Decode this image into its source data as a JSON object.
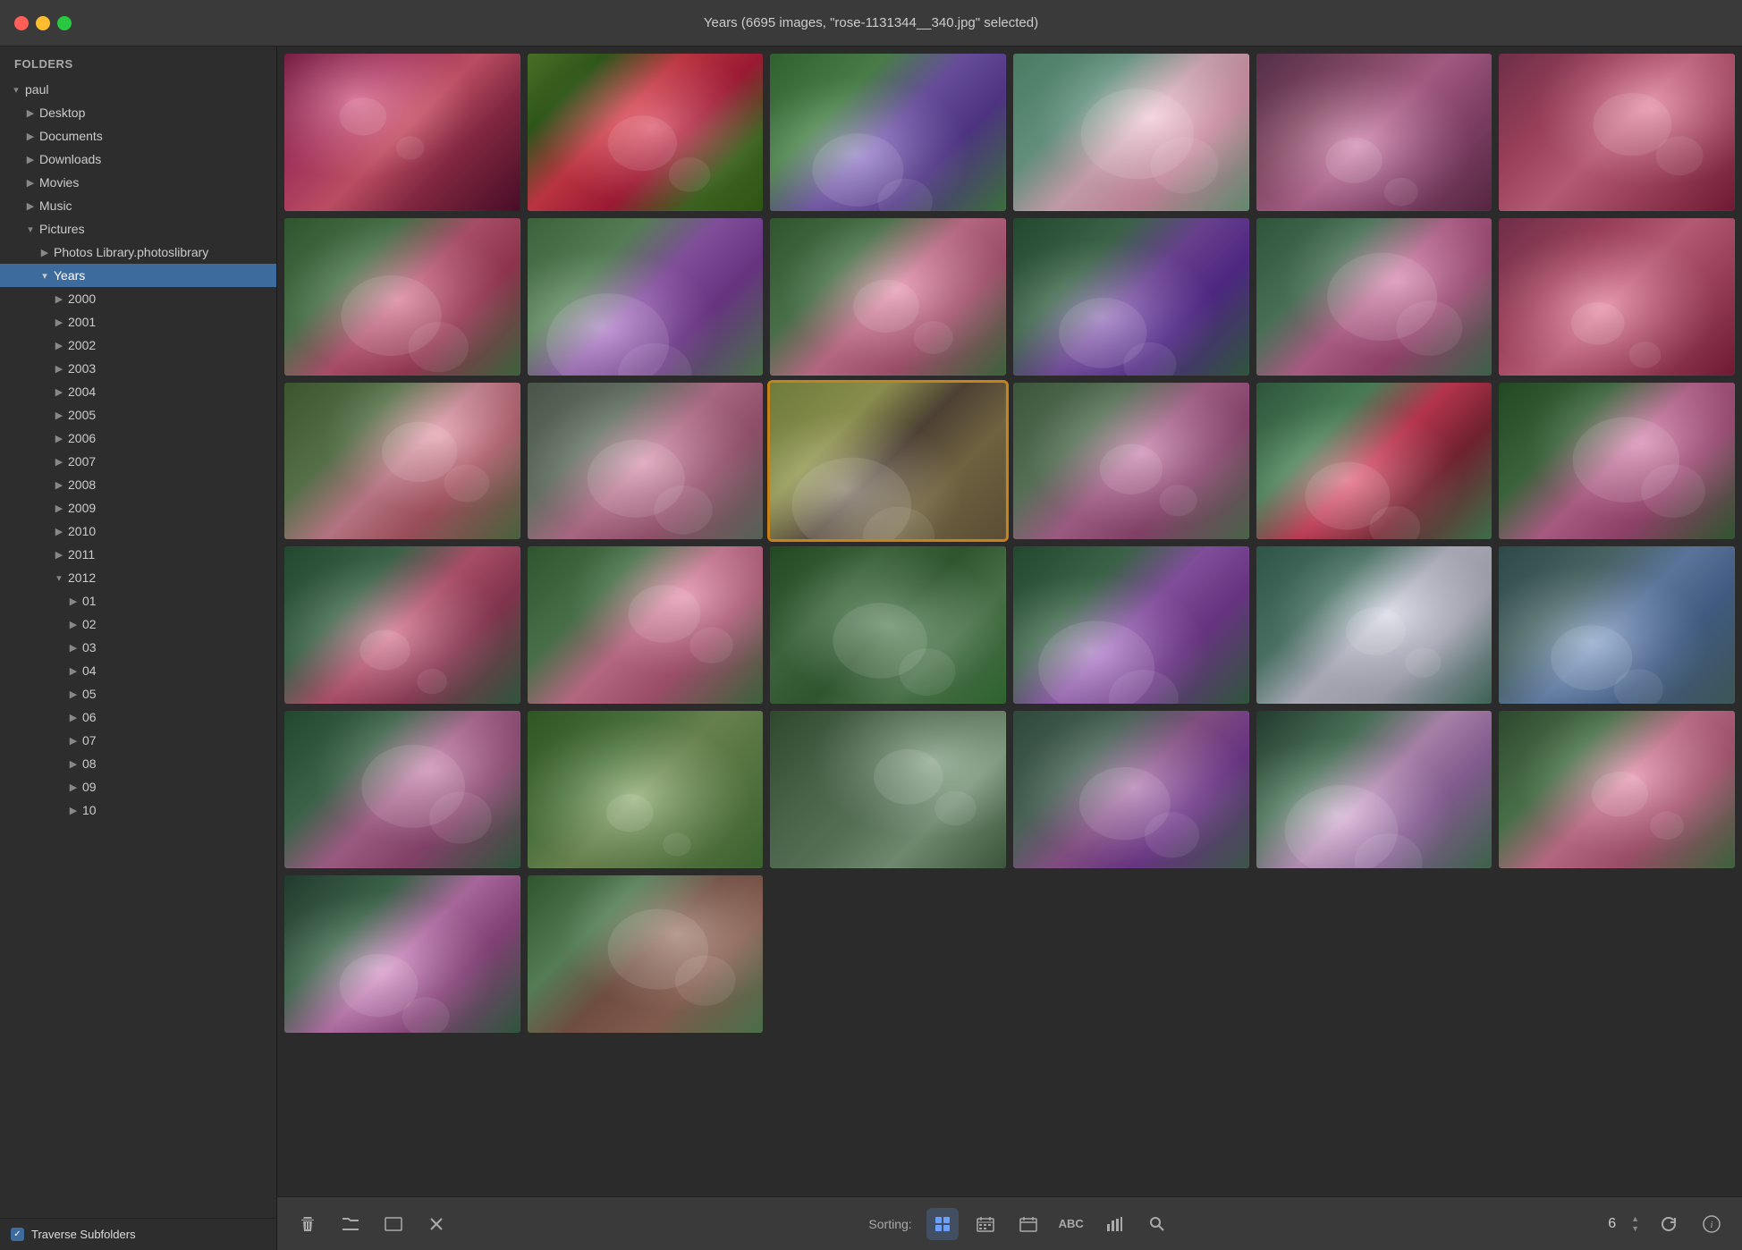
{
  "titlebar": {
    "title": "Years (6695 images, \"rose-1131344__340.jpg\" selected)"
  },
  "sidebar": {
    "header": "Folders",
    "items": [
      {
        "id": "paul",
        "label": "paul",
        "indent": 0,
        "arrow": "▾",
        "expanded": true
      },
      {
        "id": "desktop",
        "label": "Desktop",
        "indent": 1,
        "arrow": "▶",
        "expanded": false
      },
      {
        "id": "documents",
        "label": "Documents",
        "indent": 1,
        "arrow": "▶",
        "expanded": false
      },
      {
        "id": "downloads",
        "label": "Downloads",
        "indent": 1,
        "arrow": "▶",
        "expanded": false
      },
      {
        "id": "movies",
        "label": "Movies",
        "indent": 1,
        "arrow": "▶",
        "expanded": false
      },
      {
        "id": "music",
        "label": "Music",
        "indent": 1,
        "arrow": "▶",
        "expanded": false
      },
      {
        "id": "pictures",
        "label": "Pictures",
        "indent": 1,
        "arrow": "▾",
        "expanded": true
      },
      {
        "id": "photos-library",
        "label": "Photos Library.photoslibrary",
        "indent": 2,
        "arrow": "▶",
        "expanded": false
      },
      {
        "id": "years",
        "label": "Years",
        "indent": 2,
        "arrow": "▾",
        "expanded": true,
        "active": true
      },
      {
        "id": "2000",
        "label": "2000",
        "indent": 3,
        "arrow": "▶",
        "expanded": false
      },
      {
        "id": "2001",
        "label": "2001",
        "indent": 3,
        "arrow": "▶",
        "expanded": false
      },
      {
        "id": "2002",
        "label": "2002",
        "indent": 3,
        "arrow": "▶",
        "expanded": false
      },
      {
        "id": "2003",
        "label": "2003",
        "indent": 3,
        "arrow": "▶",
        "expanded": false
      },
      {
        "id": "2004",
        "label": "2004",
        "indent": 3,
        "arrow": "▶",
        "expanded": false
      },
      {
        "id": "2005",
        "label": "2005",
        "indent": 3,
        "arrow": "▶",
        "expanded": false
      },
      {
        "id": "2006",
        "label": "2006",
        "indent": 3,
        "arrow": "▶",
        "expanded": false
      },
      {
        "id": "2007",
        "label": "2007",
        "indent": 3,
        "arrow": "▶",
        "expanded": false
      },
      {
        "id": "2008",
        "label": "2008",
        "indent": 3,
        "arrow": "▶",
        "expanded": false
      },
      {
        "id": "2009",
        "label": "2009",
        "indent": 3,
        "arrow": "▶",
        "expanded": false
      },
      {
        "id": "2010",
        "label": "2010",
        "indent": 3,
        "arrow": "▶",
        "expanded": false
      },
      {
        "id": "2011",
        "label": "2011",
        "indent": 3,
        "arrow": "▶",
        "expanded": false
      },
      {
        "id": "2012",
        "label": "2012",
        "indent": 3,
        "arrow": "▾",
        "expanded": true
      },
      {
        "id": "2012-01",
        "label": "01",
        "indent": 4,
        "arrow": "▶",
        "expanded": false
      },
      {
        "id": "2012-02",
        "label": "02",
        "indent": 4,
        "arrow": "▶",
        "expanded": false
      },
      {
        "id": "2012-03",
        "label": "03",
        "indent": 4,
        "arrow": "▶",
        "expanded": false
      },
      {
        "id": "2012-04",
        "label": "04",
        "indent": 4,
        "arrow": "▶",
        "expanded": false
      },
      {
        "id": "2012-05",
        "label": "05",
        "indent": 4,
        "arrow": "▶",
        "expanded": false
      },
      {
        "id": "2012-06",
        "label": "06",
        "indent": 4,
        "arrow": "▶",
        "expanded": false
      },
      {
        "id": "2012-07",
        "label": "07",
        "indent": 4,
        "arrow": "▶",
        "expanded": false
      },
      {
        "id": "2012-08",
        "label": "08",
        "indent": 4,
        "arrow": "▶",
        "expanded": false
      },
      {
        "id": "2012-09",
        "label": "09",
        "indent": 4,
        "arrow": "▶",
        "expanded": false
      },
      {
        "id": "2012-10",
        "label": "10",
        "indent": 4,
        "arrow": "▶",
        "expanded": false
      }
    ],
    "footer": {
      "checkbox_label": "Traverse Subfolders",
      "checkbox_checked": true
    }
  },
  "toolbar": {
    "delete_label": "🗑",
    "folder_label": "📁",
    "preview_label": "□",
    "cancel_label": "✕",
    "sorting_label": "Sorting:",
    "count": "6",
    "icons": [
      "grid",
      "calendar-week",
      "calendar-month",
      "abc",
      "bar-chart",
      "search"
    ],
    "up_arrow": "▲",
    "down_arrow": "▼",
    "refresh_label": "↺",
    "info_label": "ℹ"
  },
  "photos": [
    {
      "id": 1,
      "cls": "photo-pink-rose",
      "selected": false,
      "row": 1
    },
    {
      "id": 2,
      "cls": "photo-red-flower",
      "selected": false,
      "row": 1
    },
    {
      "id": 3,
      "cls": "photo-purple-flower",
      "selected": false,
      "row": 1
    },
    {
      "id": 4,
      "cls": "photo-lily",
      "selected": false,
      "row": 1
    },
    {
      "id": 5,
      "cls": "photo-pink-dahlia",
      "selected": false,
      "row": 1
    },
    {
      "id": 6,
      "cls": "photo-pink-rose2",
      "selected": false,
      "row": 1
    },
    {
      "id": 7,
      "cls": "photo-pink-geranium",
      "selected": false,
      "row": 2
    },
    {
      "id": 8,
      "cls": "photo-purple-wild",
      "selected": false,
      "row": 2
    },
    {
      "id": 9,
      "cls": "photo-cosmos",
      "selected": false,
      "row": 2
    },
    {
      "id": 10,
      "cls": "photo-purple-flower2",
      "selected": false,
      "row": 2
    },
    {
      "id": 11,
      "cls": "photo-pink-flower2",
      "selected": false,
      "row": 2
    },
    {
      "id": 12,
      "cls": "photo-pink-rose2",
      "selected": false,
      "row": 2
    },
    {
      "id": 13,
      "cls": "photo-pink-rose3",
      "selected": false,
      "row": 3
    },
    {
      "id": 14,
      "cls": "photo-pink-rose4",
      "selected": false,
      "row": 3
    },
    {
      "id": 15,
      "cls": "photo-rose-selected",
      "selected": true,
      "row": 3
    },
    {
      "id": 16,
      "cls": "photo-pink-anemone",
      "selected": false,
      "row": 3
    },
    {
      "id": 17,
      "cls": "photo-red-waterlily",
      "selected": false,
      "row": 3
    },
    {
      "id": 18,
      "cls": "photo-pink-cosmos",
      "selected": false,
      "row": 3
    },
    {
      "id": 19,
      "cls": "photo-pink-roses",
      "selected": false,
      "row": 4
    },
    {
      "id": 20,
      "cls": "photo-pink-small",
      "selected": false,
      "row": 4
    },
    {
      "id": 21,
      "cls": "photo-green-shrub",
      "selected": false,
      "row": 4
    },
    {
      "id": 22,
      "cls": "photo-purple-small",
      "selected": false,
      "row": 4
    },
    {
      "id": 23,
      "cls": "photo-white-cluster",
      "selected": false,
      "row": 4
    },
    {
      "id": 24,
      "cls": "photo-blue-flower",
      "selected": false,
      "row": 4
    },
    {
      "id": 25,
      "cls": "photo-cosmos2",
      "selected": false,
      "row": 5
    },
    {
      "id": 26,
      "cls": "photo-garden",
      "selected": false,
      "row": 5
    },
    {
      "id": 27,
      "cls": "photo-succulent",
      "selected": false,
      "row": 5
    },
    {
      "id": 28,
      "cls": "photo-purple-rose",
      "selected": false,
      "row": 5
    },
    {
      "id": 29,
      "cls": "photo-pink-wild",
      "selected": false,
      "row": 5
    },
    {
      "id": 30,
      "cls": "photo-partial1",
      "selected": false,
      "row": 6,
      "partial": true
    },
    {
      "id": 31,
      "cls": "photo-partial2",
      "selected": false,
      "row": 6,
      "partial": true
    },
    {
      "id": 32,
      "cls": "photo-partial3",
      "selected": false,
      "row": 6,
      "partial": true
    }
  ]
}
